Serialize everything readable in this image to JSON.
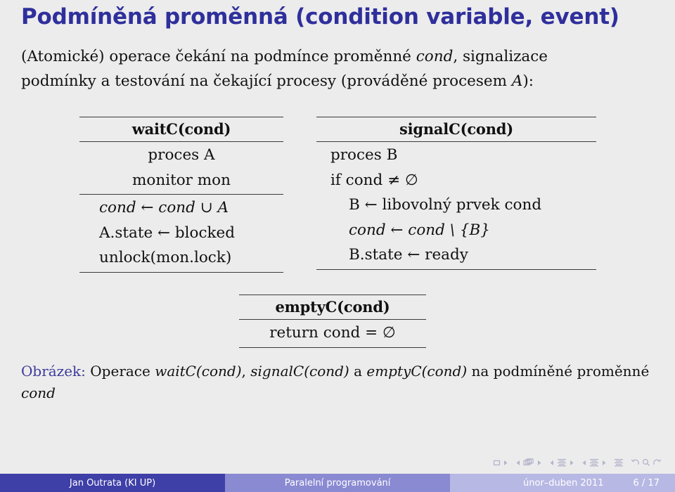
{
  "slide": {
    "title": "Podmíněná proměnná (condition variable, event)",
    "intro_line1_a": "(Atomické) operace čekání na podmínce proměnné ",
    "intro_line1_it": "cond",
    "intro_line1_b": ", signalizace",
    "intro_line2_a": "podmínky a testování na čekající procesy (prováděné procesem ",
    "intro_line2_it": "A",
    "intro_line2_b": "):",
    "title_color": "#2f2f9c",
    "background_color": "#ececec"
  },
  "table_waitc": {
    "header": "waitC(cond)",
    "upper_rows": [
      "proces A",
      "monitor mon"
    ],
    "lower_rows": [
      {
        "text": "cond ← cond ∪ A",
        "italic": true
      },
      {
        "text": "A.state ← blocked",
        "italic": false
      },
      {
        "text": "unlock(mon.lock)",
        "italic": false
      }
    ]
  },
  "table_signalc": {
    "header": "signalC(cond)",
    "rows": [
      {
        "text": "proces B",
        "indent": 0
      },
      {
        "text": "if cond ≠ ∅",
        "indent": 0
      },
      {
        "text": "B ← libovolný prvek cond",
        "indent": 1
      },
      {
        "text": "cond ← cond \\ {B}",
        "indent": 1
      },
      {
        "text": "B.state ← ready",
        "indent": 1
      }
    ]
  },
  "table_emptyc": {
    "header": "emptyC(cond)",
    "rows": [
      "return cond = ∅"
    ]
  },
  "caption": {
    "lead": "Obrázek:",
    "text_a": " Operace ",
    "op1": "waitC(cond)",
    "sep1": ", ",
    "op2": "signalC(cond)",
    "sep2": " a ",
    "op3": "emptyC(cond)",
    "text_b": " na podmíněné proměnné ",
    "op4": "cond"
  },
  "navigation_symbols": {
    "items": [
      "slide-first-icon",
      "slide-next-icon",
      "frame-prev-icon",
      "frame-icon",
      "frame-next-icon",
      "subsection-prev-icon",
      "subsection-icon",
      "subsection-next-icon",
      "section-prev-icon",
      "section-icon",
      "section-next-icon",
      "document-icon",
      "back-icon",
      "search-icon",
      "forward-icon"
    ],
    "color": "#b3b3cc"
  },
  "footer": {
    "author": "Jan Outrata  (KI UP)",
    "title": "Paralelní programování",
    "date": "únor–duben 2011",
    "page": "6 / 17",
    "author_bg": "#3f3fa8",
    "title_bg": "#8a8ad2",
    "date_bg": "#b8b8e4"
  }
}
